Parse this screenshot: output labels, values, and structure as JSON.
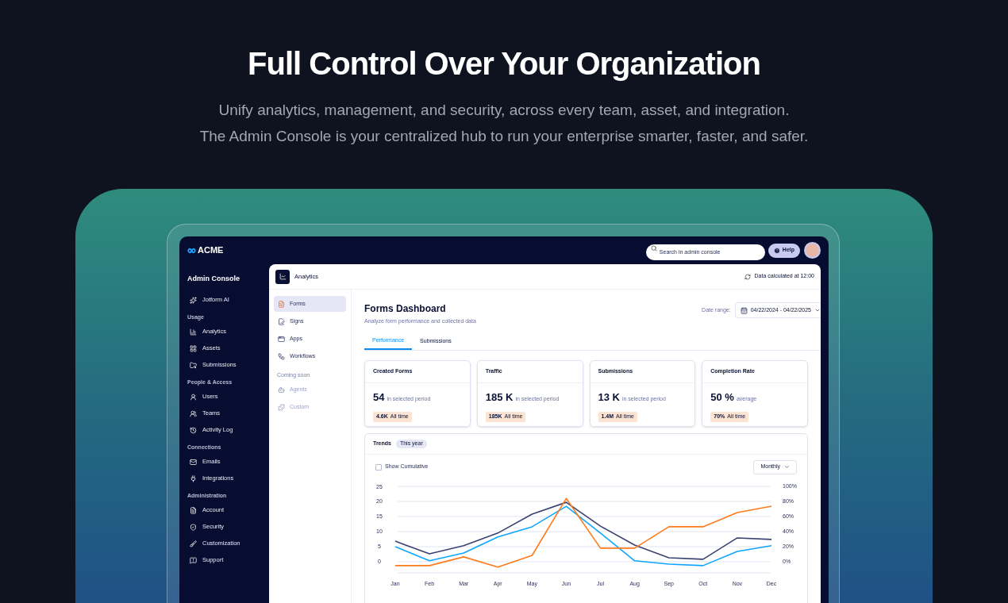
{
  "hero": {
    "title": "Full Control Over Your Organization",
    "subtitle_lines": [
      "Unify analytics, management, and security, across every team, asset, and integration.",
      "The Admin Console is your centralized hub to run your enterprise smarter, faster, and safer."
    ]
  },
  "topbar": {
    "logo": "ACME",
    "search": {
      "placeholder": "Search in admin console"
    },
    "help": "Help"
  },
  "sidebar": {
    "title": "Admin Console",
    "groups": [
      {
        "items": [
          {
            "label": "Jotform AI"
          }
        ]
      },
      {
        "label": "Usage",
        "items": [
          {
            "label": "Analytics"
          },
          {
            "label": "Assets"
          },
          {
            "label": "Submissions"
          }
        ]
      },
      {
        "label": "People & Access",
        "items": [
          {
            "label": "Users"
          },
          {
            "label": "Teams"
          },
          {
            "label": "Activity Log"
          }
        ]
      },
      {
        "label": "Connections",
        "items": [
          {
            "label": "Emails"
          },
          {
            "label": "Integrations"
          }
        ]
      },
      {
        "label": "Administration",
        "items": [
          {
            "label": "Account"
          },
          {
            "label": "Security"
          },
          {
            "label": "Customization"
          },
          {
            "label": "Support"
          }
        ]
      }
    ]
  },
  "header": {
    "title": "Analytics",
    "status": "Data calculated at 12:00"
  },
  "subnav": {
    "items": [
      {
        "label": "Forms",
        "selected": true,
        "disabled": false
      },
      {
        "label": "Signs",
        "selected": false,
        "disabled": false
      },
      {
        "label": "Apps",
        "selected": false,
        "disabled": false
      },
      {
        "label": "Workflows",
        "selected": false,
        "disabled": false
      }
    ],
    "section_label": "Coming soon",
    "soon_items": [
      {
        "label": "Agents",
        "selected": false,
        "disabled": true
      },
      {
        "label": "Custom",
        "selected": false,
        "disabled": true
      }
    ]
  },
  "dashboard": {
    "title": "Forms Dashboard",
    "subtitle": "Analyze form performance and collected data",
    "date_label": "Date range:",
    "date_value": "04/22/2024 - 04/22/2025",
    "tabs": [
      {
        "label": "Performance",
        "selected": true
      },
      {
        "label": "Submissions",
        "selected": false
      }
    ],
    "cards": [
      {
        "title": "Created Forms",
        "value": "54",
        "note": "in selected period",
        "badge_value": "4.6K",
        "badge_label": "All time"
      },
      {
        "title": "Traffic",
        "value": "185",
        "unit": "K",
        "note": "in selected period",
        "badge_value": "185K",
        "badge_label": "All time"
      },
      {
        "title": "Submissions",
        "value": "13",
        "unit": "K",
        "note": "in selected period",
        "badge_value": "1.4M",
        "badge_label": "All time"
      },
      {
        "title": "Completion Rate",
        "value": "50",
        "unit": "%",
        "note": "average",
        "badge_value": "70%",
        "badge_label": "All time"
      }
    ],
    "trends": {
      "title": "Trends",
      "period": "This year",
      "cumulative": {
        "label": "Show Cumulative",
        "checked": false
      },
      "interval": "Monthly",
      "right_axis_labels": [
        "100%",
        "80%",
        "60%",
        "40%",
        "20%",
        "0%"
      ],
      "chart_data": {
        "type": "line",
        "grid": true,
        "categories": [
          "Jan",
          "Feb",
          "Mar",
          "Apr",
          "May",
          "Jun",
          "Jul",
          "Aug",
          "Sep",
          "Oct",
          "Nov",
          "Dec"
        ],
        "ylim": [
          -3.7,
          25
        ],
        "yticks": [
          0,
          5,
          10,
          15,
          20,
          25
        ],
        "series": [
          {
            "color": "#3b4272",
            "values": [
              6.8,
              2.6,
              5.3,
              9.5,
              15.8,
              19.7,
              11.8,
              5.5,
              1.3,
              0.8,
              7.9,
              7.4
            ]
          },
          {
            "color": "#0ea5ff",
            "values": [
              5,
              0.3,
              2.9,
              8.2,
              11.6,
              18.4,
              9.5,
              0.3,
              -0.8,
              -1.3,
              3.4,
              5.3
            ]
          },
          {
            "color": "#ff7a1a",
            "values": [
              -1.3,
              -1.3,
              1.6,
              -1.8,
              2.1,
              21,
              4.5,
              4.5,
              11.6,
              11.6,
              16.3,
              18.4
            ]
          }
        ]
      }
    }
  }
}
